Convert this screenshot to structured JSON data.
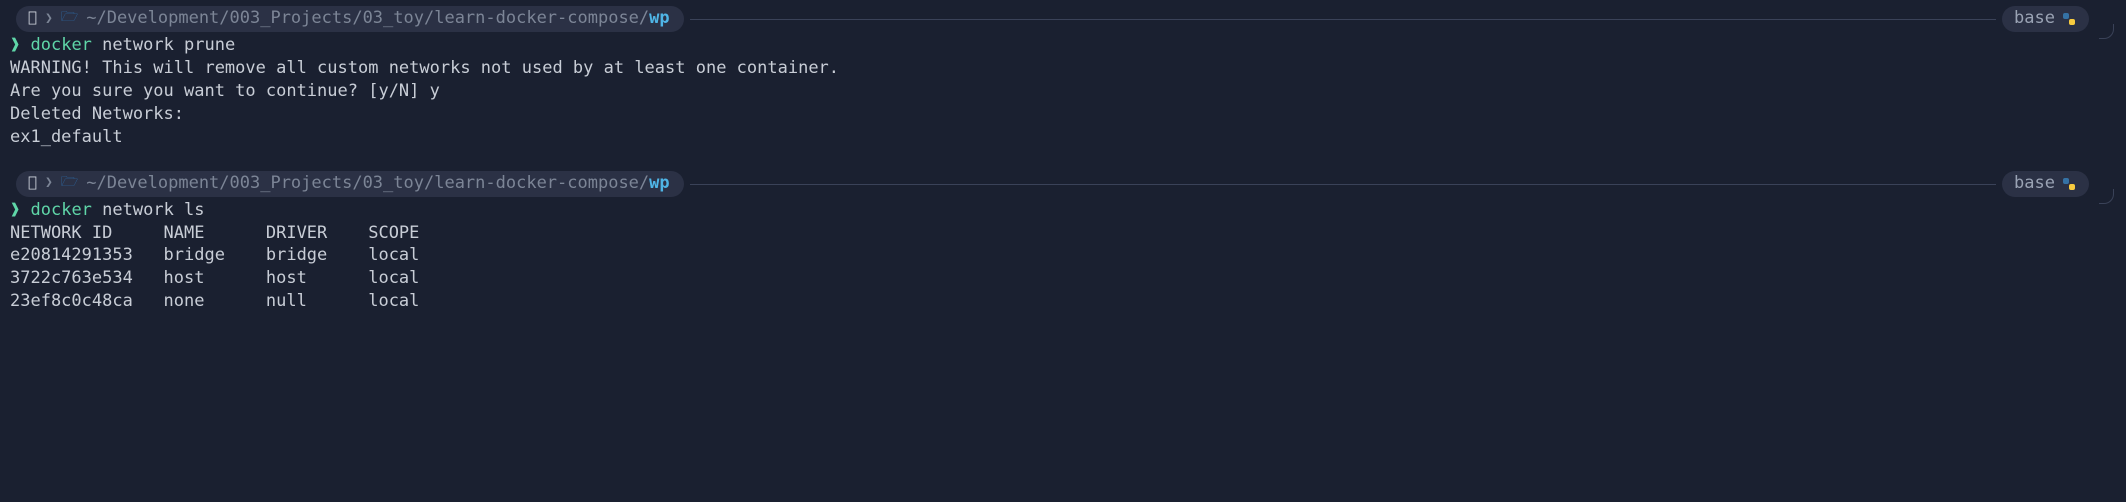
{
  "env_label": "base",
  "path_prefix": "~/Development/003_Projects/03_toy/learn-docker-compose/",
  "path_cwd": "wp",
  "blocks": [
    {
      "cmd_first": "docker",
      "cmd_rest": " network prune",
      "output": "WARNING! This will remove all custom networks not used by at least one container.\nAre you sure you want to continue? [y/N] y\nDeleted Networks:\nex1_default"
    },
    {
      "cmd_first": "docker",
      "cmd_rest": " network ls",
      "output": "NETWORK ID     NAME      DRIVER    SCOPE\ne20814291353   bridge    bridge    local\n3722c763e534   host      host      local\n23ef8c0c48ca   none      null      local"
    }
  ],
  "table_headers": [
    "NETWORK ID",
    "NAME",
    "DRIVER",
    "SCOPE"
  ],
  "table_rows": [
    {
      "id": "e20814291353",
      "name": "bridge",
      "driver": "bridge",
      "scope": "local"
    },
    {
      "id": "3722c763e534",
      "name": "host",
      "driver": "host",
      "scope": "local"
    },
    {
      "id": "23ef8c0c48ca",
      "name": "none",
      "driver": "null",
      "scope": "local"
    }
  ]
}
